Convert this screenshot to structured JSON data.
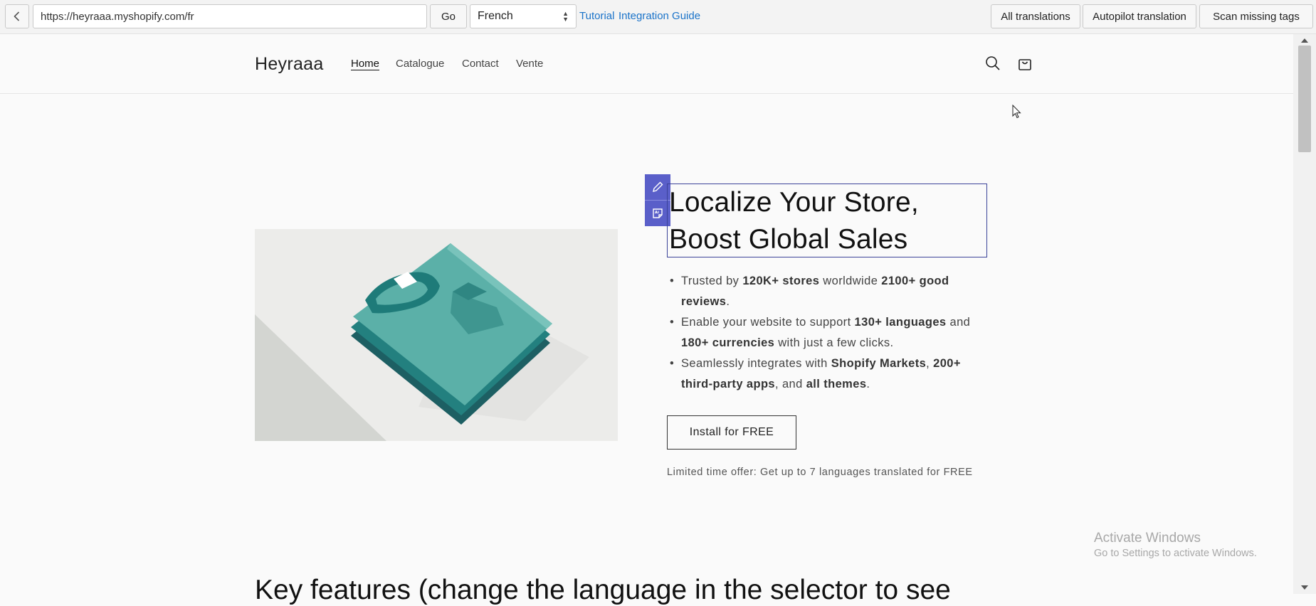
{
  "toolbar": {
    "url": "https://heyraaa.myshopify.com/fr",
    "go_label": "Go",
    "language": "French",
    "links": [
      "Tutorial",
      "Integration Guide"
    ],
    "buttons": [
      "All translations",
      "Autopilot translation",
      "Scan missing tags"
    ]
  },
  "header": {
    "brand": "Heyraaa",
    "nav": [
      "Home",
      "Catalogue",
      "Contact",
      "Vente"
    ],
    "icons": [
      "search-icon",
      "cart-icon"
    ]
  },
  "hero": {
    "title": "Localize Your Store, Boost Global Sales",
    "features": [
      {
        "t1": "Trusted by ",
        "b1": "120K+ stores",
        "t2": " worldwide ",
        "b2": "2100+ good reviews",
        "t3": ".",
        "b3": "",
        "t4": ""
      },
      {
        "t1": "Enable your website to support ",
        "b1": "130+ languages",
        "t2": " and ",
        "b2": "180+ currencies",
        "t3": " with just a few clicks.",
        "b3": "",
        "t4": ""
      },
      {
        "t1": "Seamlessly integrates with ",
        "b1": "Shopify Markets",
        "t2": ", ",
        "b2": "200+ third-party apps",
        "t3": ", and ",
        "b3": "all themes",
        "t4": "."
      }
    ],
    "install_label": "Install for FREE",
    "offer": "Limited time offer: Get up to 7 languages translated for FREE"
  },
  "watermark": {
    "line1": "Activate Windows",
    "line2": "Go to Settings to activate Windows."
  },
  "next_section": {
    "heading": "Key features (change the language in the selector to see"
  },
  "colors": {
    "accent_link": "#1a73c9",
    "edit_tool": "#5a5fc9",
    "selection_border": "#3b4399"
  }
}
